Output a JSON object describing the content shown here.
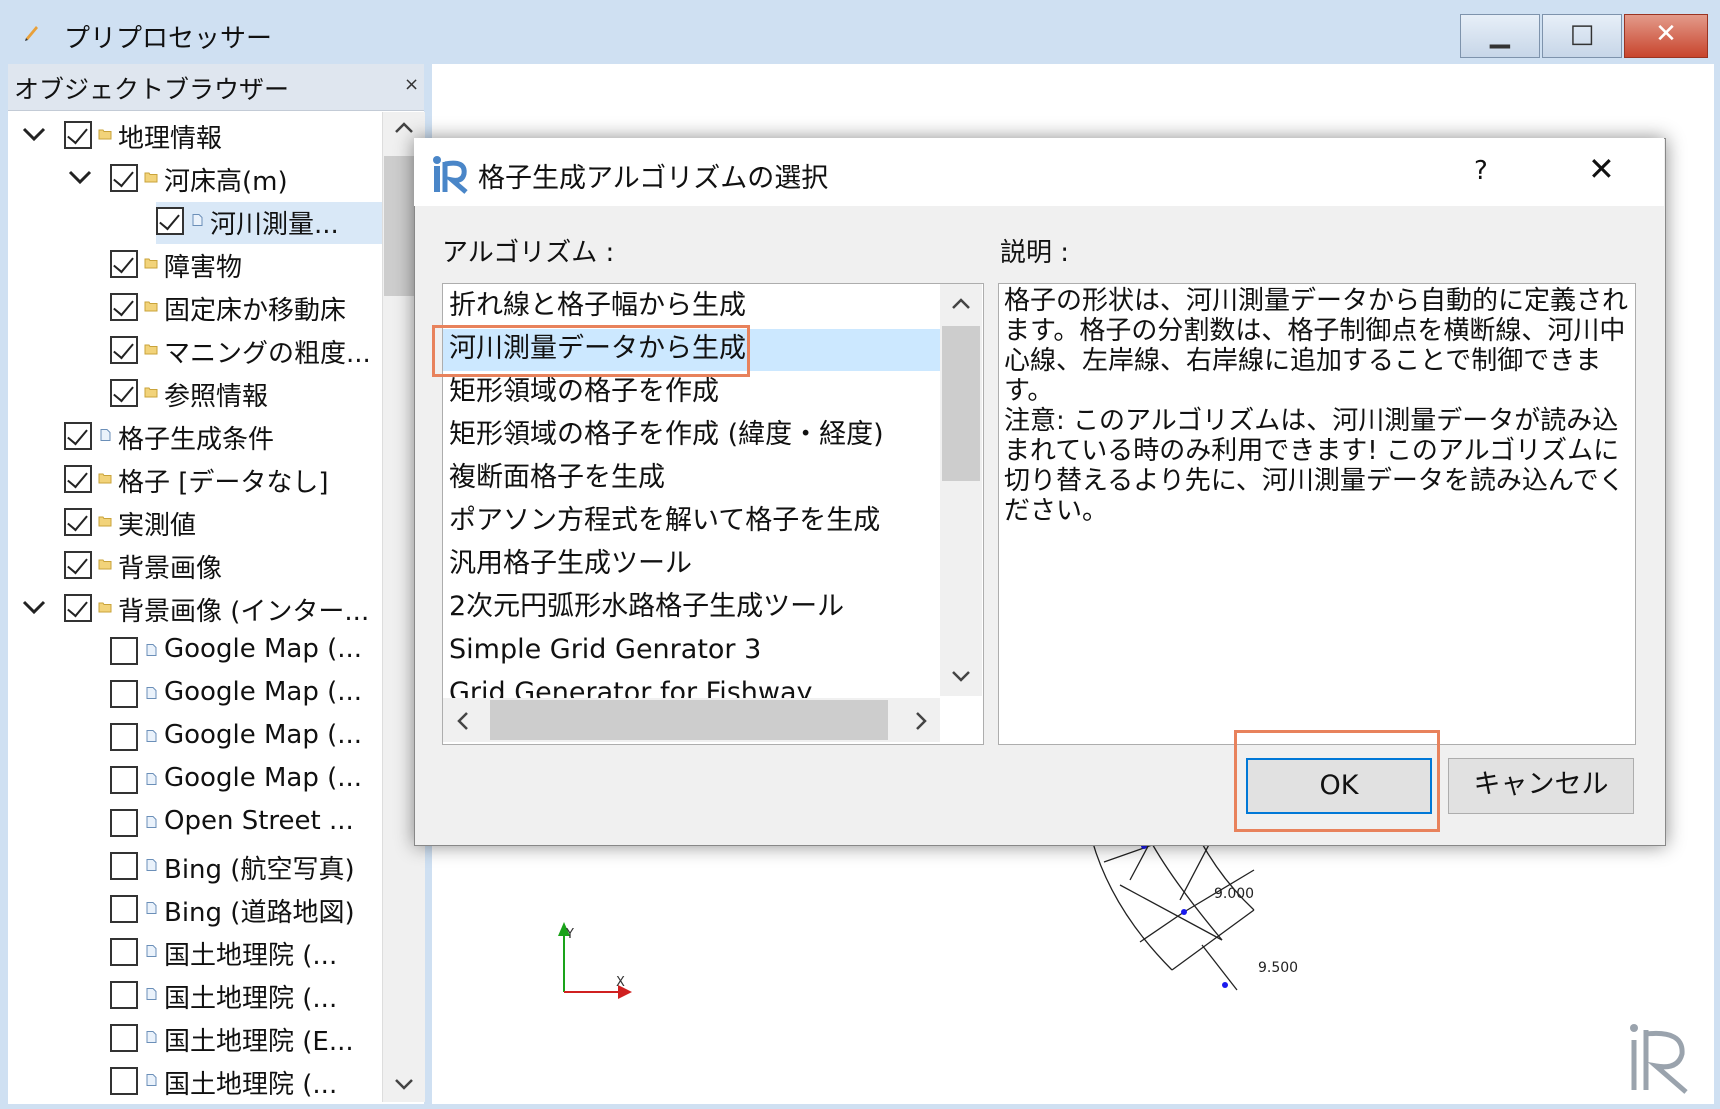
{
  "window": {
    "title": "プリプロセッサー",
    "controls": {
      "minimize": "▁",
      "maximize": "□",
      "close": "✕"
    }
  },
  "object_browser": {
    "title": "オブジェクトブラウザー",
    "close_glyph": "×",
    "items": [
      {
        "label": "地理情報",
        "checked": true,
        "expanded": true,
        "icon": "folder-icon"
      },
      {
        "label": "河床高(m)",
        "checked": true,
        "expanded": true,
        "icon": "folder-icon"
      },
      {
        "label": "河川測量...",
        "checked": true,
        "icon": "file-icon",
        "selected": true
      },
      {
        "label": "障害物",
        "checked": true,
        "icon": "folder-icon"
      },
      {
        "label": "固定床か移動床",
        "checked": true,
        "icon": "folder-icon"
      },
      {
        "label": "マニングの粗度...",
        "checked": true,
        "icon": "folder-icon"
      },
      {
        "label": "参照情報",
        "checked": true,
        "icon": "folder-icon"
      },
      {
        "label": "格子生成条件",
        "checked": true,
        "icon": "file-icon"
      },
      {
        "label": "格子 [データなし]",
        "checked": true,
        "icon": "folder-icon"
      },
      {
        "label": "実測値",
        "checked": true,
        "icon": "folder-icon"
      },
      {
        "label": "背景画像",
        "checked": true,
        "icon": "folder-icon"
      },
      {
        "label": "背景画像 (インター...",
        "checked": true,
        "expanded": true,
        "icon": "folder-icon"
      },
      {
        "label": "Google Map (...",
        "checked": false,
        "icon": "file-icon"
      },
      {
        "label": "Google Map (...",
        "checked": false,
        "icon": "file-icon"
      },
      {
        "label": "Google Map (...",
        "checked": false,
        "icon": "file-icon"
      },
      {
        "label": "Google Map (...",
        "checked": false,
        "icon": "file-icon"
      },
      {
        "label": "Open Street ...",
        "checked": false,
        "icon": "file-icon"
      },
      {
        "label": "Bing (航空写真)",
        "checked": false,
        "icon": "file-icon"
      },
      {
        "label": "Bing (道路地図)",
        "checked": false,
        "icon": "file-icon"
      },
      {
        "label": "国土地理院 (...",
        "checked": false,
        "icon": "file-icon"
      },
      {
        "label": "国土地理院 (...",
        "checked": false,
        "icon": "file-icon"
      },
      {
        "label": "国土地理院 (E...",
        "checked": false,
        "icon": "file-icon"
      },
      {
        "label": "国土地理院 (...",
        "checked": false,
        "icon": "file-icon"
      }
    ]
  },
  "canvas": {
    "axis_y": "Y",
    "axis_x": "X",
    "grid_labels": [
      "9.000",
      "9.500"
    ]
  },
  "dialog": {
    "title": "格子生成アルゴリズムの選択",
    "help": "?",
    "close": "✕",
    "algorithm_label": "アルゴリズム :",
    "description_label": "説明 :",
    "algorithms": [
      "折れ線と格子幅から生成",
      "河川測量データから生成",
      "矩形領域の格子を作成",
      "矩形領域の格子を作成 (緯度・経度)",
      "複断面格子を生成",
      "ポアソン方程式を解いて格子を生成",
      "汎用格子生成ツール",
      "2次元円弧形水路格子生成ツール",
      "Simple Grid Genrator 3",
      "Grid Generator for Fishway"
    ],
    "selected_algorithm": "河川測量データから生成",
    "description": "格子の形状は、河川測量データから自動的に定義されます。格子の分割数は、格子制御点を横断線、河川中心線、左岸線、右岸線に追加することで制御できます。\n注意: このアルゴリズムは、河川測量データが読み込まれている時のみ利用できます! このアルゴリズムに切り替えるより先に、河川測量データを読み込んでください。",
    "ok_label": "OK",
    "cancel_label": "キャンセル",
    "highlight_color": "#e8825c"
  }
}
